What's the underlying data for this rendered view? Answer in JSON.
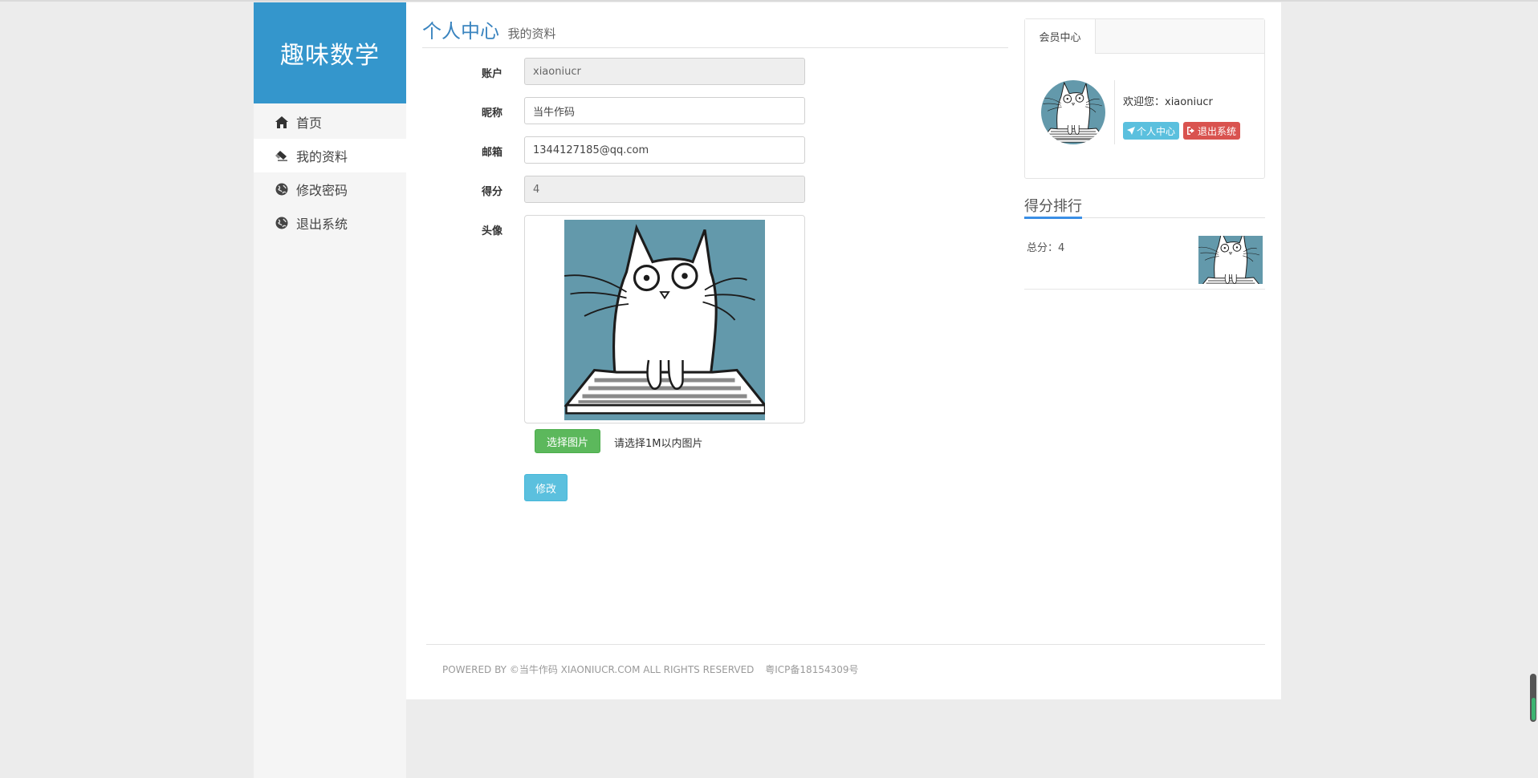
{
  "brand": {
    "name": "趣味数学",
    "color": "#3496cc"
  },
  "sidebar": {
    "items": [
      {
        "label": "首页",
        "icon": "home-icon",
        "active": false
      },
      {
        "label": "我的资料",
        "icon": "eraser-icon",
        "active": true
      },
      {
        "label": "修改密码",
        "icon": "globe-icon",
        "active": false
      },
      {
        "label": "退出系统",
        "icon": "globe-icon",
        "active": false
      }
    ]
  },
  "page": {
    "title": "个人中心",
    "subtitle": "我的资料"
  },
  "form": {
    "account": {
      "label": "账户",
      "value": "xiaoniucr"
    },
    "nickname": {
      "label": "昵称",
      "value": "当牛作码"
    },
    "email": {
      "label": "邮箱",
      "value": "1344127185@qq.com"
    },
    "score": {
      "label": "得分",
      "value": "4"
    },
    "avatar": {
      "label": "头像",
      "image": "cat-on-keyboard"
    },
    "choose_image_label": "选择图片",
    "upload_hint": "请选择1M以内图片",
    "submit_label": "修改"
  },
  "member_panel": {
    "tab": "会员中心",
    "welcome": "欢迎您：xiaoniucr",
    "profile_button": "个人中心",
    "logout_button": "退出系统"
  },
  "ranking": {
    "title": "得分排行",
    "entries": [
      {
        "score_text": "总分：4",
        "image": "cat-on-keyboard"
      }
    ]
  },
  "footer": {
    "text": "POWERED BY ©当牛作码 XIAONIUCR.COM ALL RIGHTS RESERVED",
    "icp": "粤ICP备18154309号"
  },
  "colors": {
    "primary_blue": "#3496cc",
    "success": "#5cb85c",
    "info": "#5bc0de",
    "danger": "#d9534f",
    "avatar_bg": "#6399ab"
  }
}
